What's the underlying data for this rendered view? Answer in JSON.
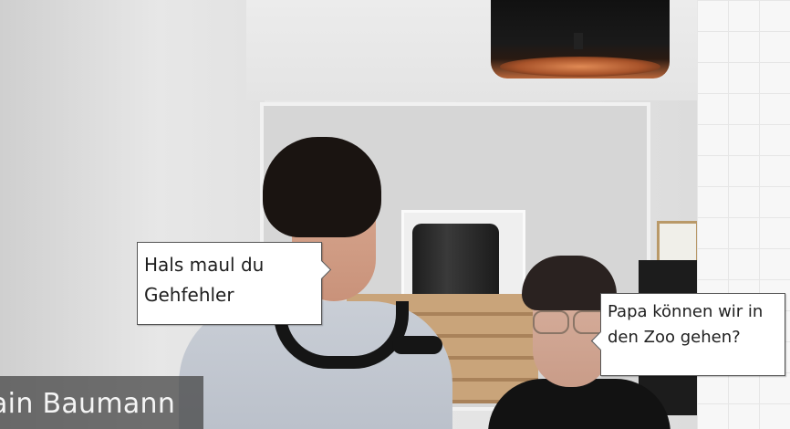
{
  "video": {
    "participant_name": "ain Baumann"
  },
  "bubbles": [
    {
      "line1": "Hals maul du",
      "line2": "Gehfehler"
    },
    {
      "line1": "Papa können wir in",
      "line2": "den Zoo gehen?"
    }
  ],
  "icons": {
    "whiteboard": "grid-canvas"
  }
}
